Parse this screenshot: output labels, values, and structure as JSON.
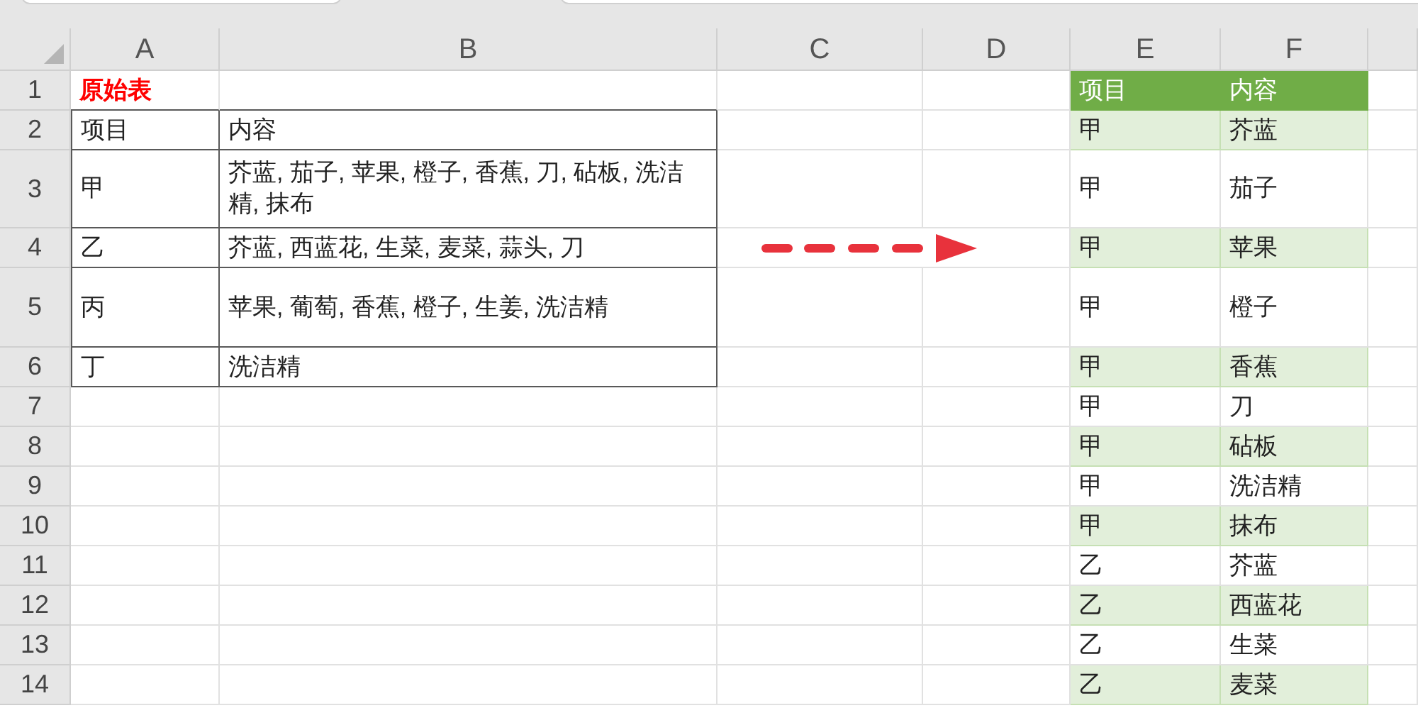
{
  "column_headers": [
    "A",
    "B",
    "C",
    "D",
    "E",
    "F"
  ],
  "row_headers": [
    "1",
    "2",
    "3",
    "4",
    "5",
    "6",
    "7",
    "8",
    "9",
    "10",
    "11",
    "12",
    "13",
    "14"
  ],
  "original_table": {
    "title": "原始表",
    "header": [
      "项目",
      "内容"
    ],
    "rows": [
      {
        "item": "甲",
        "content": "芥蓝, 茄子, 苹果, 橙子, 香蕉, 刀, 砧板, 洗洁精, 抹布"
      },
      {
        "item": "乙",
        "content": "芥蓝, 西蓝花, 生菜, 麦菜, 蒜头, 刀"
      },
      {
        "item": "丙",
        "content": "苹果, 葡萄, 香蕉, 橙子, 生姜, 洗洁精"
      },
      {
        "item": "丁",
        "content": "洗洁精"
      }
    ]
  },
  "result_table": {
    "header": [
      "项目",
      "内容"
    ],
    "rows": [
      {
        "item": "甲",
        "content": "芥蓝",
        "shaded": true
      },
      {
        "item": "甲",
        "content": "茄子",
        "shaded": false
      },
      {
        "item": "甲",
        "content": "苹果",
        "shaded": true
      },
      {
        "item": "甲",
        "content": "橙子",
        "shaded": false
      },
      {
        "item": "甲",
        "content": "香蕉",
        "shaded": true
      },
      {
        "item": "甲",
        "content": "刀",
        "shaded": false
      },
      {
        "item": "甲",
        "content": "砧板",
        "shaded": true
      },
      {
        "item": "甲",
        "content": "洗洁精",
        "shaded": false
      },
      {
        "item": "甲",
        "content": "抹布",
        "shaded": true
      },
      {
        "item": "乙",
        "content": "芥蓝",
        "shaded": false
      },
      {
        "item": "乙",
        "content": "西蓝花",
        "shaded": true
      },
      {
        "item": "乙",
        "content": "生菜",
        "shaded": false
      },
      {
        "item": "乙",
        "content": "麦菜",
        "shaded": true
      }
    ]
  }
}
